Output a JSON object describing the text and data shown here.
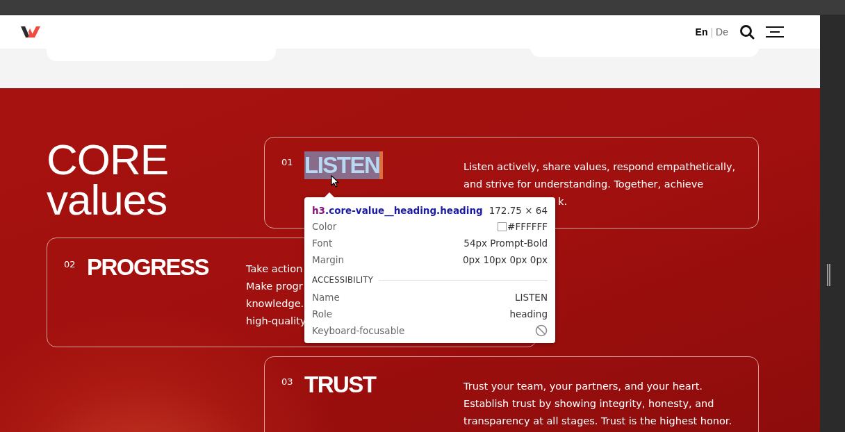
{
  "header": {
    "languages": [
      {
        "label": "En",
        "selected": true
      },
      {
        "label": "De",
        "selected": false
      }
    ],
    "separator": "|"
  },
  "section": {
    "title_lines": [
      "CORE",
      "values"
    ],
    "values": [
      {
        "number": "01",
        "heading": "LISTEN",
        "inspected": true,
        "lines": [
          {
            "kind": "full",
            "text": "Listen actively, share values, respond empathetically,"
          },
          {
            "kind": "full",
            "text": "and strive for understanding. Together, achieve"
          },
          {
            "kind": "tail",
            "text": "k."
          }
        ]
      },
      {
        "number": "02",
        "heading": "PROGRESS",
        "inspected": false,
        "lines": [
          {
            "kind": "full",
            "text": "Take action"
          },
          {
            "kind": "full",
            "text": "Make progr"
          },
          {
            "kind": "full",
            "text": "knowledge."
          },
          {
            "kind": "full",
            "text": "high-quality"
          }
        ]
      },
      {
        "number": "03",
        "heading": "TRUST",
        "inspected": false,
        "lines": [
          {
            "kind": "full",
            "text": "Trust your team, your partners, and your heart."
          },
          {
            "kind": "full",
            "text": "Establish trust by showing integrity, honesty, and"
          },
          {
            "kind": "full",
            "text": "transparency at all stages. Trust is the highest honor."
          }
        ]
      }
    ]
  },
  "inspector_tooltip": {
    "tag": "h3",
    "classes": ".core-value__heading.heading",
    "size": "172.75 × 64",
    "styles": [
      {
        "kind": "swatch",
        "label": "Color",
        "value": "#FFFFFF"
      },
      {
        "kind": "text",
        "label": "Font",
        "value": "54px Prompt-Bold"
      },
      {
        "kind": "text",
        "label": "Margin",
        "value": "0px 10px 0px 0px"
      }
    ],
    "accessibility_title": "ACCESSIBILITY",
    "accessibility": [
      {
        "kind": "text",
        "label": "Name",
        "value": "LISTEN"
      },
      {
        "kind": "text",
        "label": "Role",
        "value": "heading"
      },
      {
        "kind": "flag",
        "label": "Keyboard-focusable",
        "on": false
      }
    ]
  }
}
